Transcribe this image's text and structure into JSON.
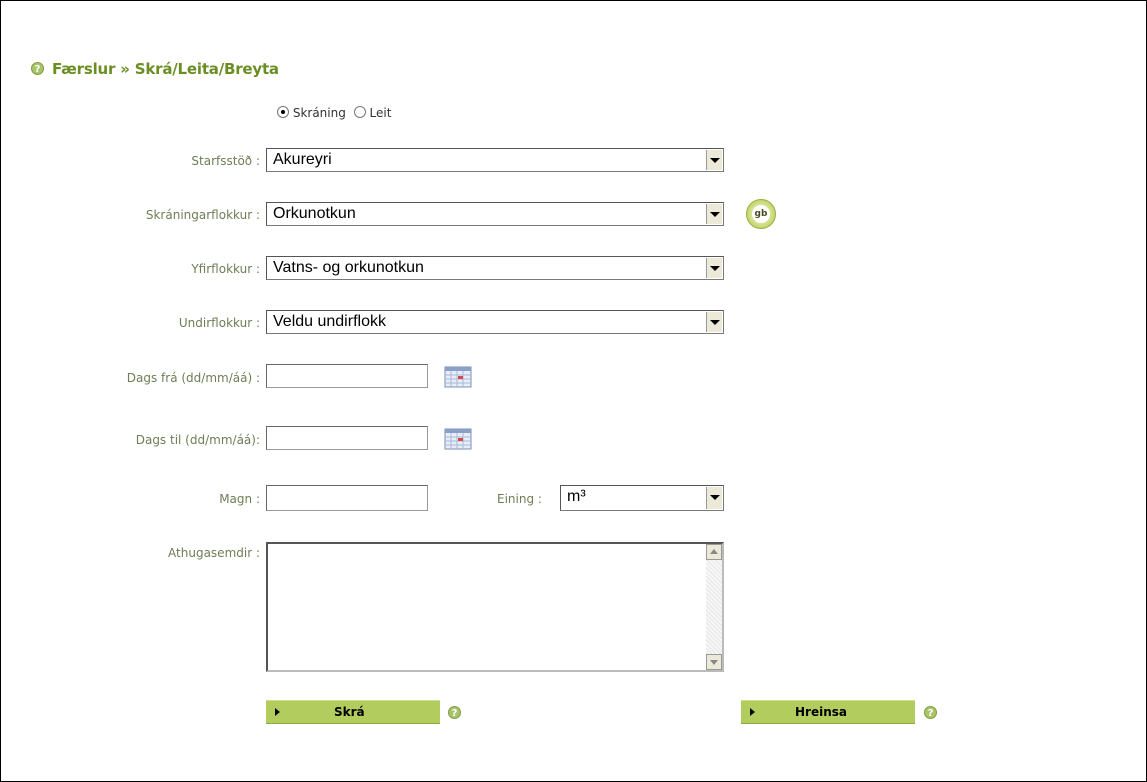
{
  "page": {
    "title": "Færslur » Skrá/Leita/Breyta"
  },
  "mode": {
    "options": [
      {
        "label": "Skráning",
        "selected": true
      },
      {
        "label": "Leit",
        "selected": false
      }
    ]
  },
  "form": {
    "starfsstod": {
      "label": "Starfsstöð :",
      "value": "Akureyri"
    },
    "skraningarflokkur": {
      "label": "Skráningarflokkur :",
      "value": "Orkunotkun"
    },
    "yfirflokkur": {
      "label": "Yfirflokkur :",
      "value": "Vatns- og orkunotkun"
    },
    "undirflokkur": {
      "label": "Undirflokkur :",
      "value": "Veldu undirflokk"
    },
    "dags_fra": {
      "label": "Dags frá (dd/mm/áá) :",
      "value": ""
    },
    "dags_til": {
      "label": "Dags til (dd/mm/áá):",
      "value": ""
    },
    "magn": {
      "label": "Magn :",
      "value": ""
    },
    "eining": {
      "label": "Eining :",
      "value": "m³"
    },
    "athugasemdir": {
      "label": "Athugasemdir :",
      "value": ""
    }
  },
  "icons": {
    "help": "help-icon",
    "calendar": "calendar-icon",
    "gb": "gb-icon",
    "gb_text": "gb"
  },
  "actions": {
    "submit_label": "Skrá",
    "clear_label": "Hreinsa"
  },
  "colors": {
    "accent": "#6b8e23",
    "button": "#b3cc5e",
    "label": "#6f7d55"
  }
}
